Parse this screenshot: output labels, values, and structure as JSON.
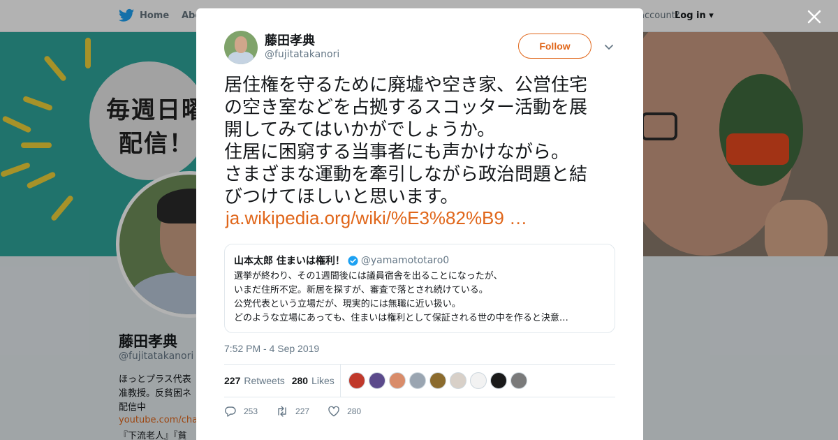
{
  "nav": {
    "home_label": "Home",
    "about_label": "Abo",
    "account_text": "account?",
    "login_label": "Log in"
  },
  "banner": {
    "bubble_text": "毎週日曜\n配信！"
  },
  "profile": {
    "name": "藤田孝典",
    "handle": "@fujitatakanori",
    "bio_lines": [
      "ほっとプラス代表",
      "准教授。反貧困ネ",
      "配信中"
    ],
    "link": "youtube.com/char",
    "books": "『下流老人』『貧"
  },
  "tweet": {
    "author_name": "藤田孝典",
    "author_handle": "@fujitatakanori",
    "follow_label": "Follow",
    "text_lines": [
      "居住権を守るために廃墟や空き家、公営住宅",
      "の空き室などを占拠するスコッター活動を展",
      "開してみてはいかがでしょうか。",
      "住居に困窮する当事者にも声かけながら。",
      "さまざまな運動を牽引しながら政治問題と結",
      "びつけてほしいと思います。"
    ],
    "link_text": "ja.wikipedia.org/wiki/%E3%82%B9 …",
    "quote": {
      "name": "山本太郎 住まいは権利！",
      "handle": "@yamamototaro0",
      "lines": [
        "選挙が終わり、その1週間後には議員宿舎を出ることになったが、",
        "いまだ住所不定。新居を探すが、審査で落とされ続けている。",
        "公党代表という立場だが、現実的には無職に近い扱い。",
        "どのような立場にあっても、住まいは権利として保証される世の中を作ると決意…"
      ]
    },
    "timestamp": "7:52 PM - 4 Sep 2019",
    "retweets_count": "227",
    "retweets_label": "Retweets",
    "likes_count": "280",
    "likes_label": "Likes",
    "liker_colors": [
      "#c0392b",
      "#5b4a8b",
      "#d98c6a",
      "#9aa5b1",
      "#8b6b2e",
      "#d8d0c8",
      "#f2f2f2",
      "#1a1a1a",
      "#7a7a7a"
    ],
    "reply_count": "253",
    "retweet_action_count": "227",
    "like_action_count": "280"
  },
  "colors": {
    "accent": "#e0661a",
    "twitter_blue": "#1da1f2",
    "banner_teal": "#2fa59b",
    "verified_blue": "#1da1f2"
  }
}
